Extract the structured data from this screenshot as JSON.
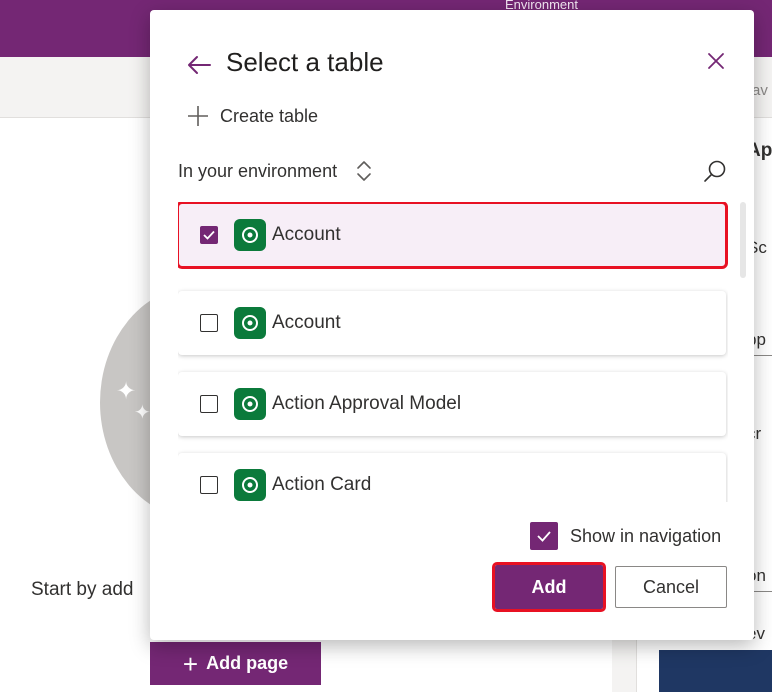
{
  "app": {
    "environment_label": "Environment",
    "right_edge_text": "av",
    "start_text": "Start by add",
    "add_page_label": "Add page",
    "right_panel": {
      "heading": "Ap",
      "text_1": "Sc",
      "text_2": "pp",
      "text_3": "cr",
      "text_4": "on",
      "text_5": "ev"
    }
  },
  "dialog": {
    "title": "Select a table",
    "create_label": "Create table",
    "filter_label": "In your environment",
    "items": [
      {
        "label": "Account",
        "checked": true
      },
      {
        "label": "Account",
        "checked": false
      },
      {
        "label": "Action Approval Model",
        "checked": false
      },
      {
        "label": "Action Card",
        "checked": false
      }
    ],
    "show_in_nav_label": "Show in navigation",
    "show_in_nav_checked": true,
    "add_label": "Add",
    "cancel_label": "Cancel"
  },
  "colors": {
    "brand": "#742774",
    "highlight": "#e81123",
    "dataverse_icon": "#0b7a3b"
  },
  "icons": [
    "back-arrow-icon",
    "close-icon",
    "plus-icon",
    "sort-icon",
    "search-icon",
    "dataverse-icon",
    "checkmark-icon",
    "sparkle-icon"
  ]
}
